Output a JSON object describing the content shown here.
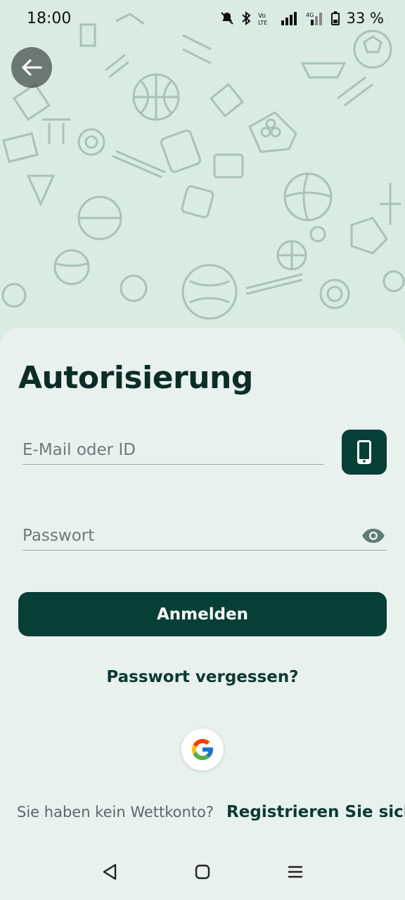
{
  "status_bar": {
    "time": "18:00",
    "battery": "33 %",
    "icons": [
      "muted-bell-icon",
      "bluetooth-icon",
      "volte-icon",
      "signal-icon",
      "4g-signal-icon",
      "battery-icon"
    ]
  },
  "header": {
    "back_icon": "arrow-left-icon"
  },
  "form": {
    "title": "Autorisierung",
    "email_placeholder": "E-Mail oder ID",
    "phone_toggle_icon": "smartphone-icon",
    "password_placeholder": "Passwort",
    "password_visibility_icon": "eye-icon",
    "login_label": "Anmelden",
    "forgot_label": "Passwort vergessen?",
    "google_icon": "google-icon",
    "no_account_text": "Sie haben kein Wettkonto?",
    "register_label": "Registrieren Sie sich"
  },
  "nav": {
    "icons": [
      "back-triangle-icon",
      "home-square-icon",
      "menu-icon"
    ]
  },
  "colors": {
    "primary": "#063f36",
    "background": "#e9f1ef",
    "pattern_bg": "#d9ebe2",
    "pattern_stroke": "#a9c2b6"
  }
}
